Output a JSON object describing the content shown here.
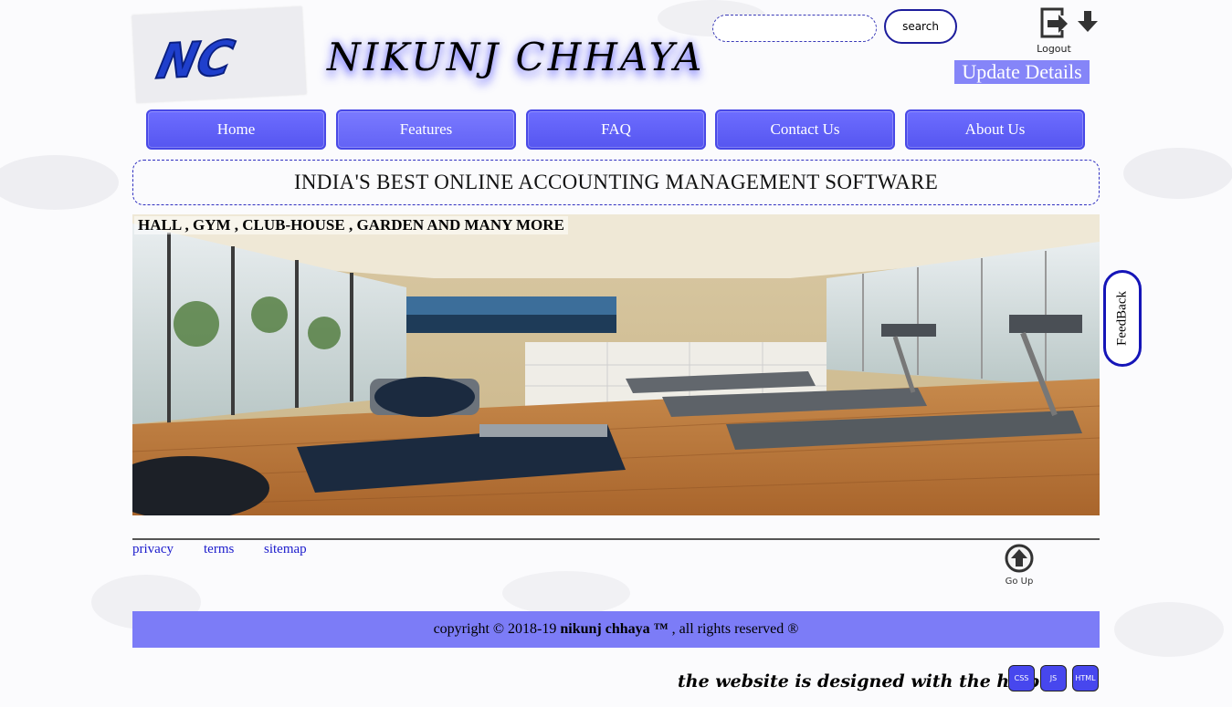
{
  "header": {
    "site_title": "NIKUNJ CHHAYA",
    "logo_text": "NC",
    "search": {
      "placeholder": "",
      "value": "",
      "button_label": "search"
    },
    "logout_label": "Logout",
    "update_details_label": "Update Details"
  },
  "nav": {
    "items": [
      {
        "label": "Home"
      },
      {
        "label": "Features"
      },
      {
        "label": "FAQ"
      },
      {
        "label": "Contact Us"
      },
      {
        "label": "About Us"
      }
    ]
  },
  "tagline": "INDIA'S BEST ONLINE ACCOUNTING MANAGEMENT SOFTWARE",
  "banner": {
    "caption": "HALL , GYM , CLUB-HOUSE , GARDEN AND MANY MORE"
  },
  "feedback_label": "FeedBack",
  "footer": {
    "links": [
      {
        "label": "privacy"
      },
      {
        "label": "terms"
      },
      {
        "label": "sitemap"
      }
    ],
    "go_up_label": "Go Up",
    "copyright_prefix": "copyright © 2018-19 ",
    "copyright_name": "nikunj chhaya ™",
    "copyright_suffix": " , all rights reserved ®",
    "designed_text": "the website is designed with the help of",
    "tech_badges": [
      "CSS",
      "JS",
      "HTML"
    ]
  },
  "colors": {
    "accent": "#6d6dff",
    "bar": "#7c7cf7",
    "link": "#1a1acc",
    "border": "#1515b8"
  }
}
